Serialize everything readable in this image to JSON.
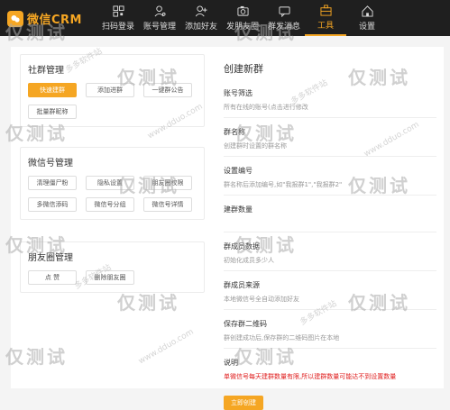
{
  "app": {
    "logo_text": "微信CRM"
  },
  "nav": [
    {
      "label": "扫码登录",
      "icon": "qrcode-icon"
    },
    {
      "label": "账号管理",
      "icon": "user-settings-icon"
    },
    {
      "label": "添加好友",
      "icon": "add-friend-icon"
    },
    {
      "label": "发朋友圈",
      "icon": "camera-icon"
    },
    {
      "label": "群发消息",
      "icon": "message-icon"
    },
    {
      "label": "工具",
      "icon": "toolbox-icon"
    },
    {
      "label": "设置",
      "icon": "home-icon"
    }
  ],
  "left": {
    "groups": [
      {
        "title": "社群管理",
        "buttons": [
          "快速建群",
          "添加进群",
          "一键群公告",
          "批量群昵称"
        ]
      },
      {
        "title": "微信号管理",
        "buttons": [
          "清理僵尸粉",
          "隐私设置",
          "朋友圈权限",
          "多微信添码",
          "微信号分组",
          "微信号详情"
        ]
      },
      {
        "title": "朋友圈管理",
        "buttons": [
          "点 赞",
          "删除朋友圈"
        ]
      }
    ]
  },
  "form": {
    "title": "创建新群",
    "fields": [
      {
        "label": "账号筛选",
        "value": "所有在线的账号(点击进行修改"
      },
      {
        "label": "群名称",
        "value": "创建群时设置的群名称"
      },
      {
        "label": "设置编号",
        "value": "群名称后添加编号,如\"我报群1\",\"我报群2\""
      },
      {
        "label": "建群数量",
        "value": ""
      },
      {
        "label": "群成员数据",
        "value": "初始化成员多少人"
      },
      {
        "label": "群成员来源",
        "value": "本地微信号全自动添加好友"
      },
      {
        "label": "保存群二维码",
        "value": "群创建成功后,保存群的二维码图片在本地"
      },
      {
        "label": "说明",
        "value": "单微信号每天建群数量有限,所以建群数量可能达不到设置数量"
      }
    ],
    "submit_label": "立即创建"
  },
  "watermarks": {
    "large": "仅测试",
    "small": "多多软件站",
    "url": "www.dduo.com"
  },
  "colors": {
    "accent": "#f5a623",
    "topbar": "#1f1f1f",
    "warning": "#e02020"
  }
}
